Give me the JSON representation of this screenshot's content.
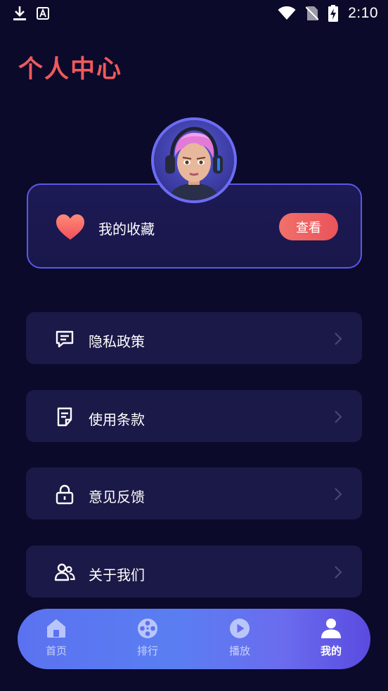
{
  "status_bar": {
    "time": "2:10"
  },
  "page": {
    "title": "个人中心"
  },
  "favorites": {
    "label": "我的收藏",
    "button": "查看"
  },
  "menu": [
    {
      "label": "隐私政策",
      "icon": "message-square-icon"
    },
    {
      "label": "使用条款",
      "icon": "document-icon"
    },
    {
      "label": "意见反馈",
      "icon": "lock-icon"
    },
    {
      "label": "关于我们",
      "icon": "users-icon"
    }
  ],
  "bottom_nav": [
    {
      "label": "首页",
      "icon": "home-icon",
      "active": false
    },
    {
      "label": "排行",
      "icon": "film-reel-icon",
      "active": false
    },
    {
      "label": "播放",
      "icon": "play-circle-icon",
      "active": false
    },
    {
      "label": "我的",
      "icon": "user-icon",
      "active": true
    }
  ],
  "colors": {
    "background": "#0b0a2b",
    "accent": "#f0595c",
    "card": "#1b1947",
    "card_border": "#5b59e6"
  }
}
